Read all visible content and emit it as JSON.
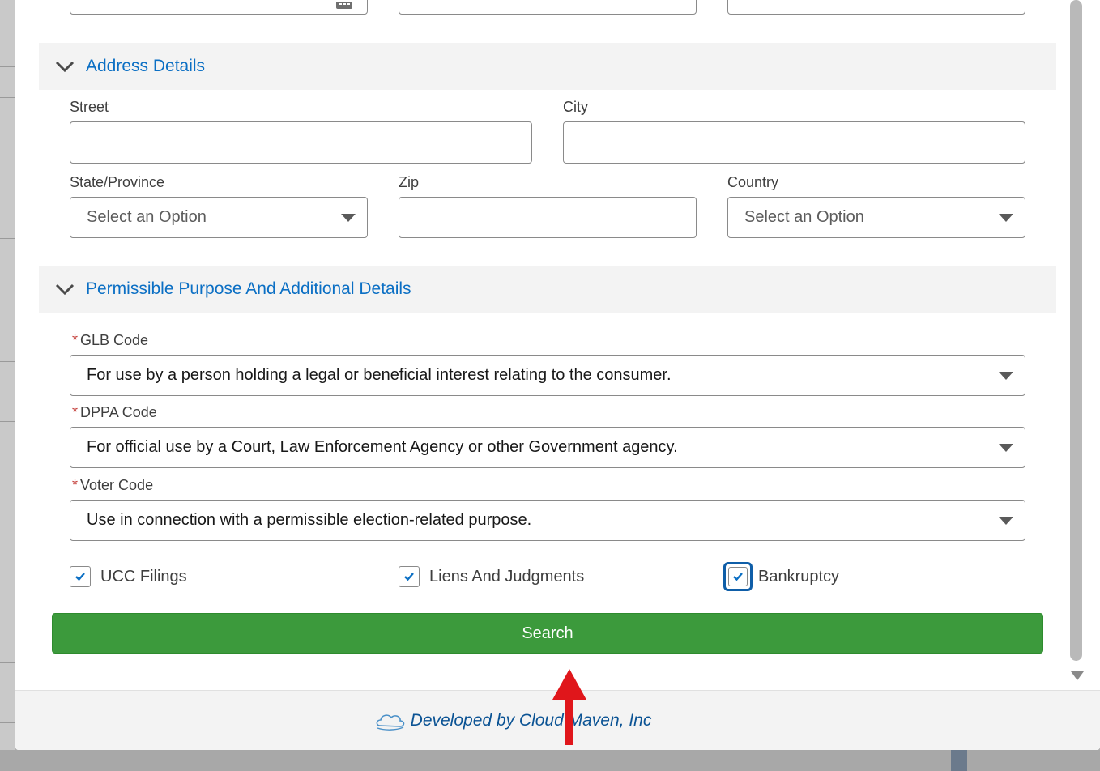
{
  "address_section": {
    "title": "Address Details",
    "street_label": "Street",
    "city_label": "City",
    "state_label": "State/Province",
    "state_placeholder": "Select an Option",
    "zip_label": "Zip",
    "country_label": "Country",
    "country_placeholder": "Select an Option"
  },
  "purpose_section": {
    "title": "Permissible Purpose And Additional Details",
    "required_mark": "*",
    "glb_label": "GLB Code",
    "glb_value": "For use by a person holding a legal or beneficial interest relating to the consumer.",
    "dppa_label": "DPPA Code",
    "dppa_value": "For official use by a Court, Law Enforcement Agency or other Government agency.",
    "voter_label": "Voter Code",
    "voter_value": "Use in connection with a permissible election-related purpose."
  },
  "checkboxes": [
    {
      "label": "UCC Filings",
      "checked": true
    },
    {
      "label": "Liens And Judgments",
      "checked": true
    },
    {
      "label": "Bankruptcy",
      "checked": true,
      "focused": true
    }
  ],
  "search_button": "Search",
  "footer": {
    "text": "Developed by Cloud Maven, Inc",
    "icon": "cloud-logo-icon"
  },
  "colors": {
    "accent": "#0b6fc4",
    "button": "#3c9a3c",
    "required": "#c23934",
    "focus": "#0f5ea8",
    "annotation_arrow": "#e0161b"
  }
}
